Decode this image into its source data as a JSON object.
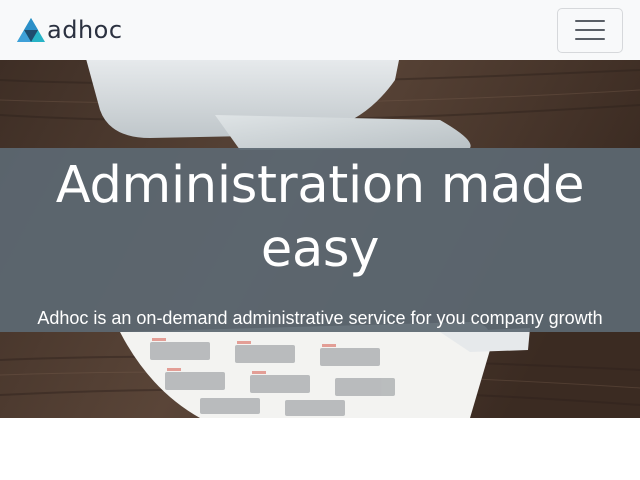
{
  "navbar": {
    "brand": "adhoc",
    "logo_icon": "triangle-logo-icon",
    "menu_icon": "hamburger-menu-icon",
    "background": "#f8f9fa"
  },
  "hero": {
    "title": "Administration made easy",
    "subtitle": "Adhoc is an on-demand administrative service for you company growth",
    "overlay_color": "#5c6872"
  },
  "colors": {
    "brand_text": "#2b3140",
    "logo_blue": "#2c8fc8",
    "logo_teal": "#27b3c6",
    "logo_dark": "#1f4c6e"
  }
}
